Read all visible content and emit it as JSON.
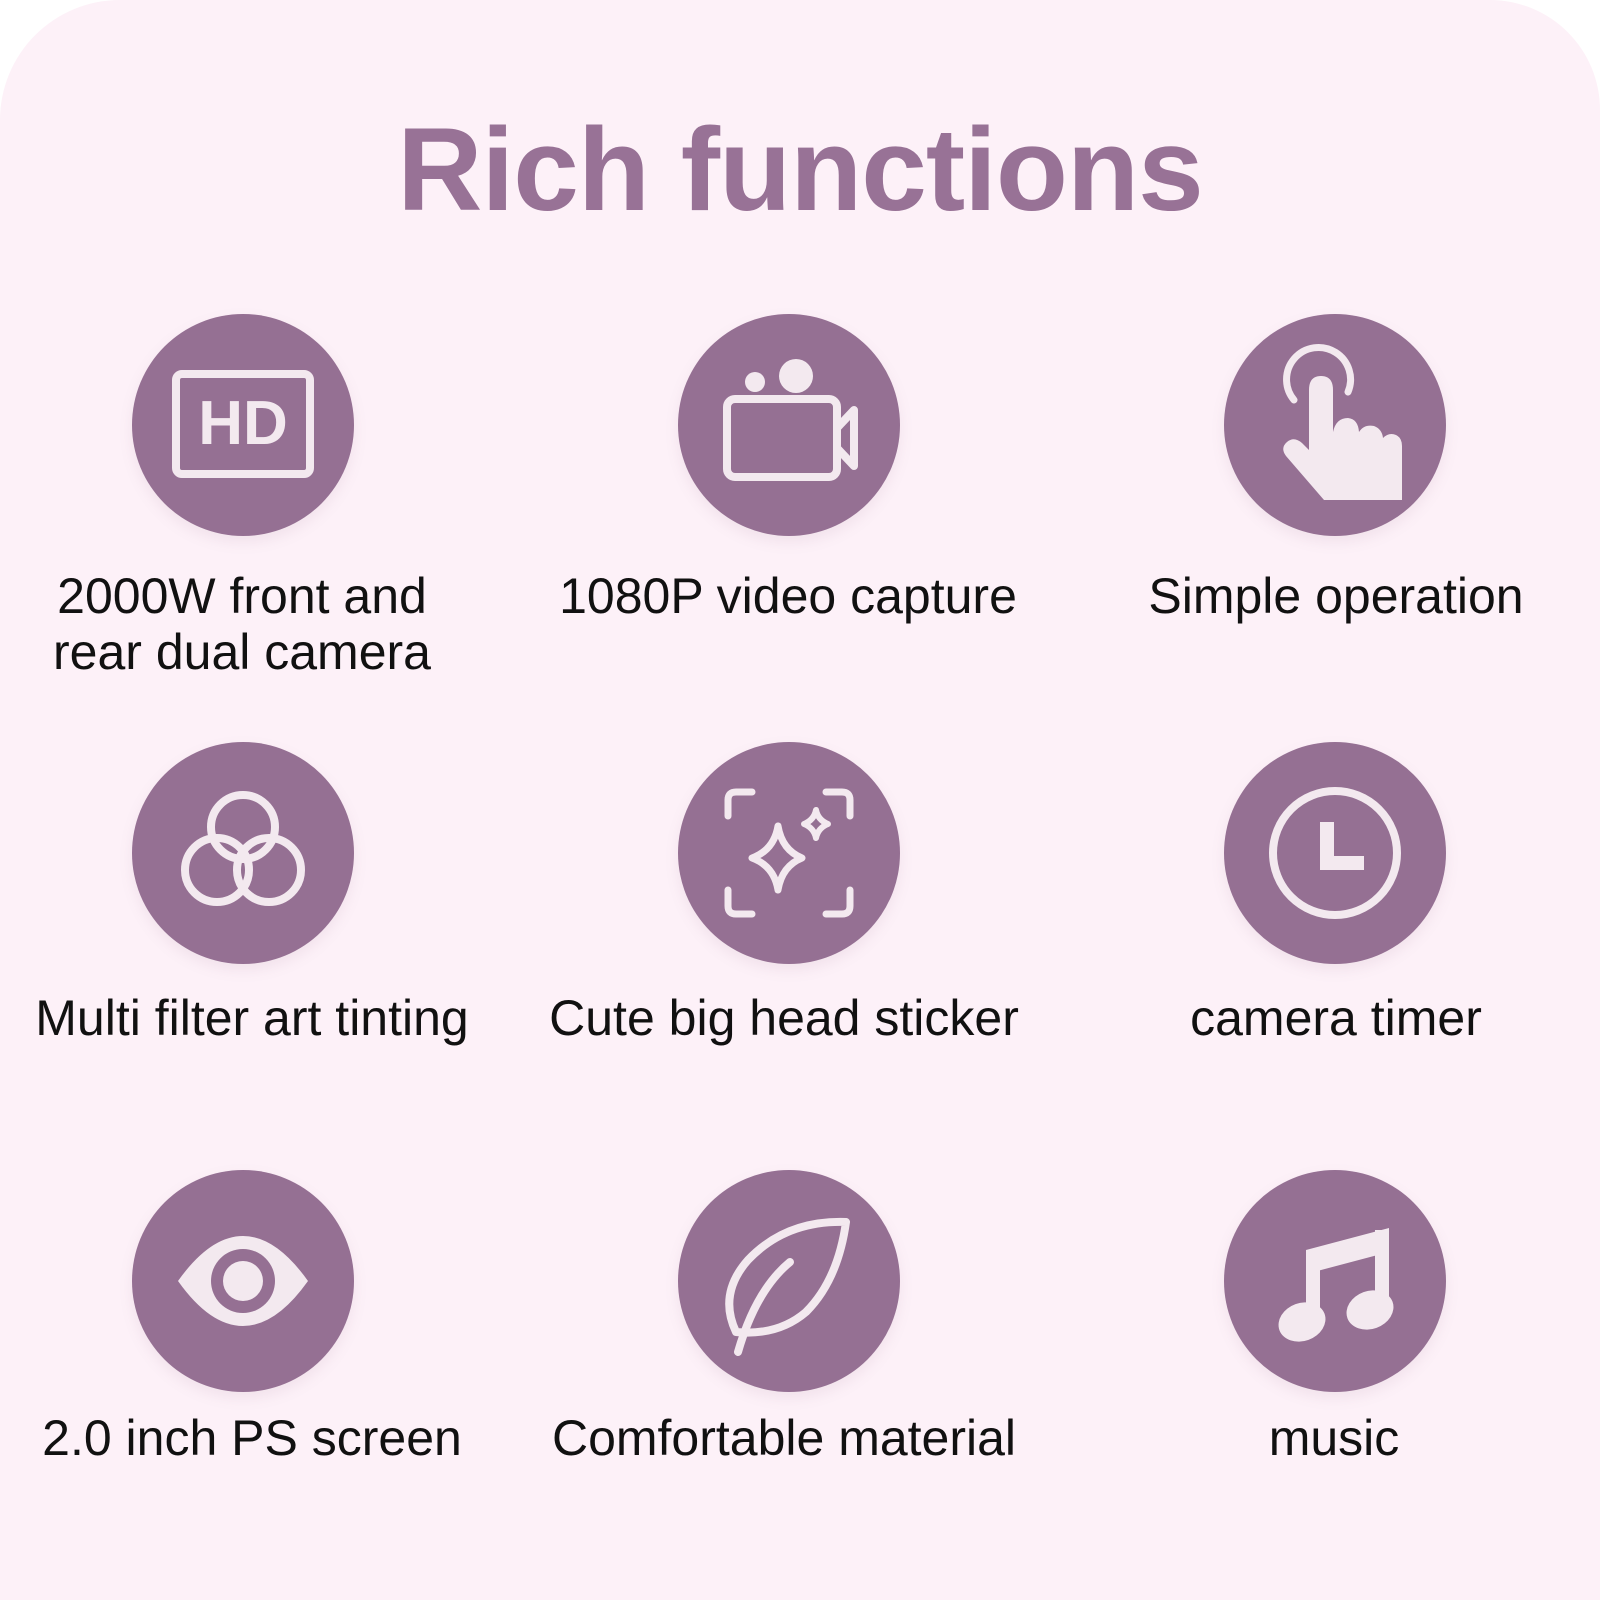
{
  "title": "Rich functions",
  "colors": {
    "background": "#fdf1f8",
    "accent": "#957093",
    "title": "#987296",
    "icon_fill": "#f3e9ef",
    "text": "#111111"
  },
  "features": [
    {
      "icon": "hd-icon",
      "label": "2000W front and\nrear dual camera",
      "icon_text": "HD"
    },
    {
      "icon": "video-camera-icon",
      "label": "1080P video capture"
    },
    {
      "icon": "touch-hand-icon",
      "label": "Simple operation"
    },
    {
      "icon": "color-filter-icon",
      "label": "Multi filter art tinting"
    },
    {
      "icon": "sticker-sparkle-icon",
      "label": "Cute big head sticker"
    },
    {
      "icon": "clock-icon",
      "label": "camera timer"
    },
    {
      "icon": "eye-icon",
      "label": "2.0 inch PS screen"
    },
    {
      "icon": "leaf-icon",
      "label": "Comfortable material"
    },
    {
      "icon": "music-note-icon",
      "label": "music"
    }
  ]
}
